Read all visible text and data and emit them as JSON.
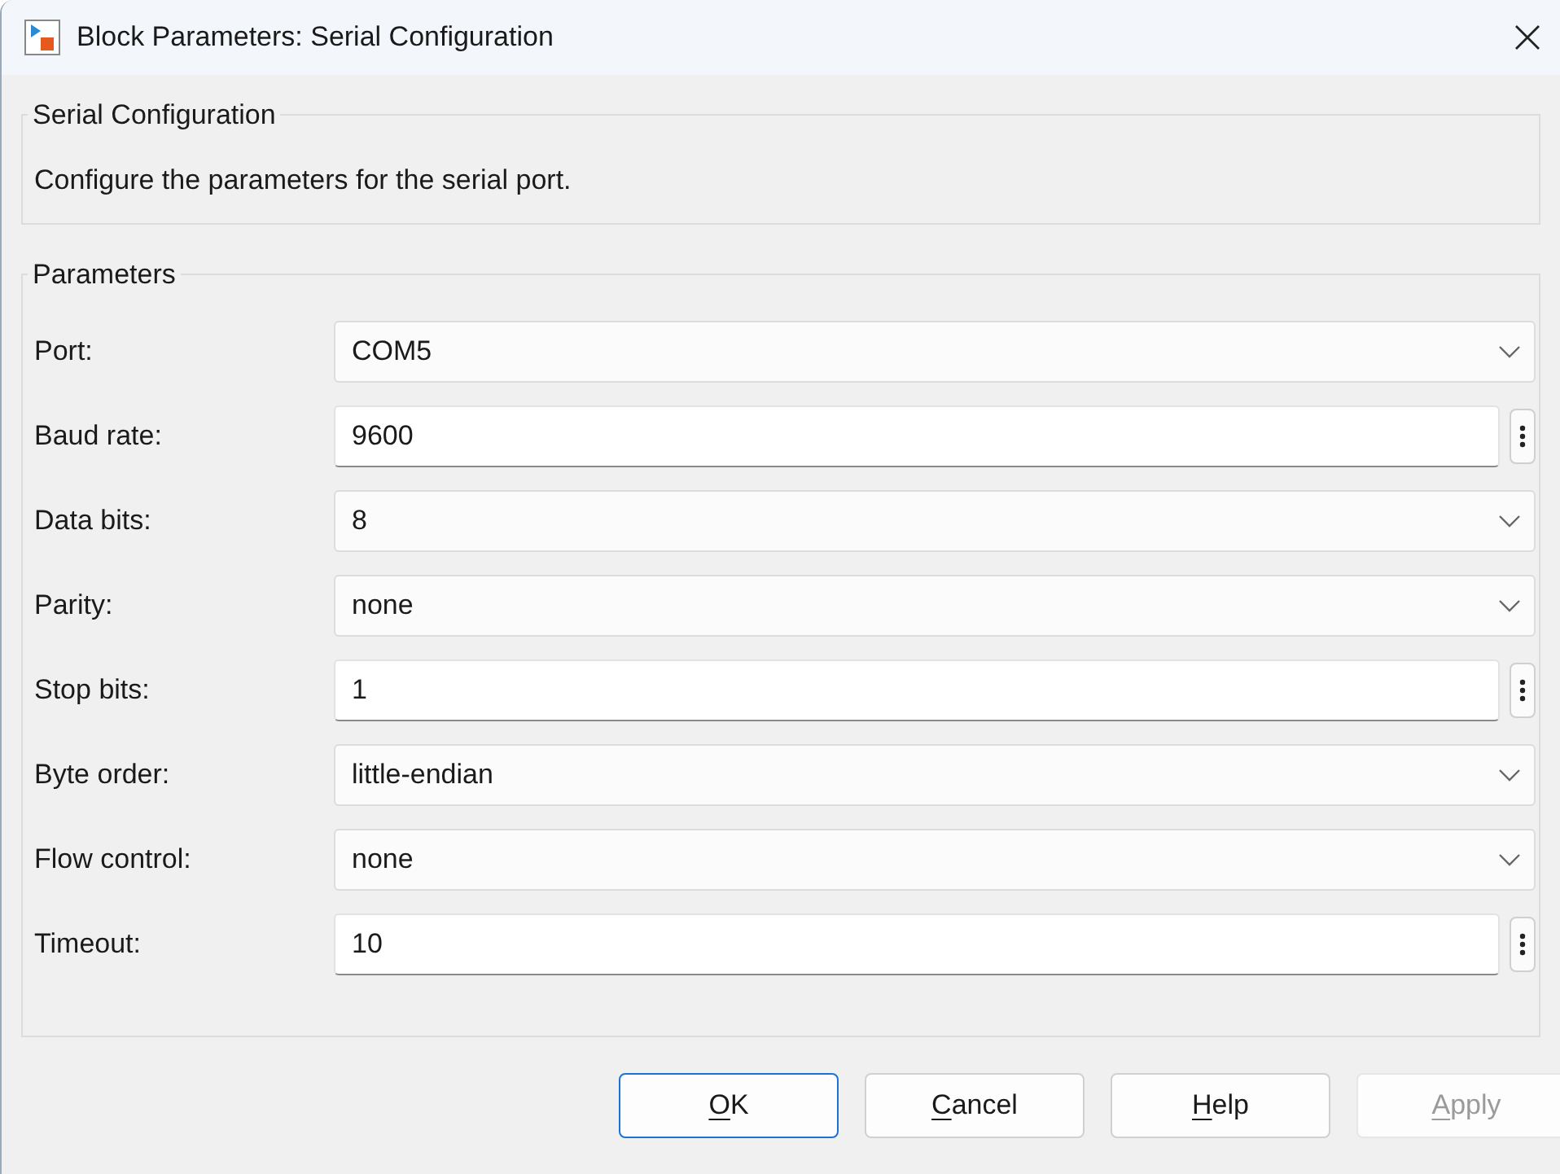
{
  "window": {
    "title": "Block Parameters: Serial Configuration"
  },
  "description_group": {
    "title": "Serial Configuration",
    "text": "Configure the parameters for the serial port."
  },
  "parameters_group": {
    "title": "Parameters",
    "rows": [
      {
        "label": "Port:",
        "kind": "dropdown",
        "value": "COM5"
      },
      {
        "label": "Baud rate:",
        "kind": "edit",
        "value": "9600"
      },
      {
        "label": "Data bits:",
        "kind": "dropdown",
        "value": "8"
      },
      {
        "label": "Parity:",
        "kind": "dropdown",
        "value": "none"
      },
      {
        "label": "Stop bits:",
        "kind": "edit",
        "value": "1"
      },
      {
        "label": "Byte order:",
        "kind": "dropdown",
        "value": "little-endian"
      },
      {
        "label": "Flow control:",
        "kind": "dropdown",
        "value": "none"
      },
      {
        "label": "Timeout:",
        "kind": "edit",
        "value": "10"
      }
    ]
  },
  "buttons": [
    {
      "label": "OK",
      "default": true,
      "disabled": false
    },
    {
      "label": "Cancel",
      "default": false,
      "disabled": false
    },
    {
      "label": "Help",
      "default": false,
      "disabled": false
    },
    {
      "label": "Apply",
      "default": false,
      "disabled": true
    }
  ]
}
